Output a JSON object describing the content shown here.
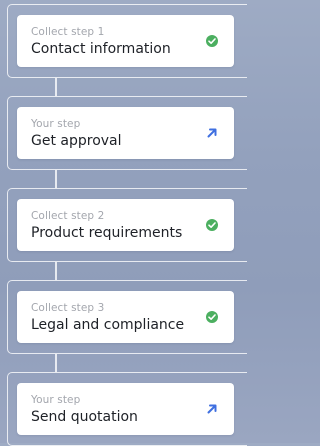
{
  "steps": [
    {
      "subtitle": "Collect step 1",
      "title": "Contact information",
      "status_icon": "check-circle-icon"
    },
    {
      "subtitle": "Your step",
      "title": "Get approval",
      "status_icon": "arrow-up-right-icon"
    },
    {
      "subtitle": "Collect step 2",
      "title": "Product requirements",
      "status_icon": "check-circle-icon"
    },
    {
      "subtitle": "Collect step 3",
      "title": "Legal and compliance",
      "status_icon": "check-circle-icon"
    },
    {
      "subtitle": "Your step",
      "title": "Send quotation",
      "status_icon": "arrow-up-right-icon"
    }
  ],
  "colors": {
    "check": "#4caf60",
    "arrow": "#3f6fe0",
    "frame": "#ffffff"
  }
}
